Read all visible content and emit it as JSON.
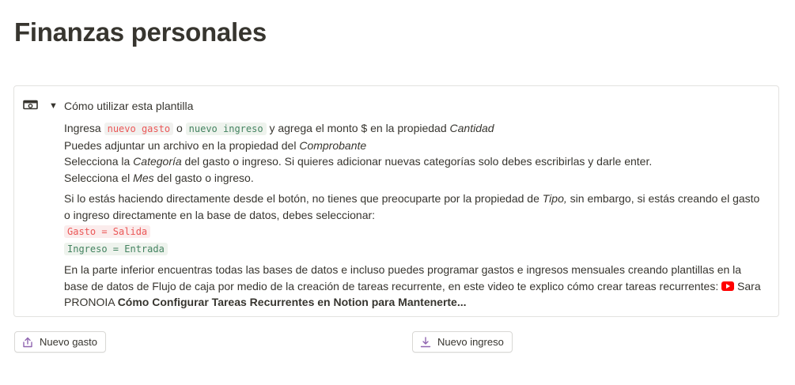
{
  "page": {
    "title": "Finanzas personales"
  },
  "callout": {
    "icon": "money-icon",
    "toggle_title": "Cómo utilizar esta plantilla",
    "line1": {
      "a": "Ingresa ",
      "code1": "nuevo gasto",
      "b": " o ",
      "code2": "nuevo ingreso",
      "c": " y agrega el monto $ en la propiedad ",
      "em": "Cantidad"
    },
    "line2": {
      "a": "Puedes adjuntar un archivo en la propiedad del ",
      "em": "Comprobante"
    },
    "line3": {
      "a": "Selecciona la ",
      "em": "Categoría",
      "b": " del gasto o ingreso. Si quieres adicionar nuevas categorías solo debes escribirlas y darle enter."
    },
    "line4": {
      "a": "Selecciona el ",
      "em": "Mes",
      "b": " del gasto o ingreso."
    },
    "para2": {
      "a": "Si lo estás haciendo directamente desde el botón, no tienes que preocuparte por la propiedad de ",
      "em": "Tipo,",
      "b": " sin embargo, si estás creando el gasto o ingreso directamente en la base de datos, debes seleccionar:"
    },
    "code_gasto": "Gasto = Salida",
    "code_ingreso": "Ingreso = Entrada",
    "para3": {
      "a": "En la parte inferior encuentras todas las bases de datos e incluso puedes programar gastos e ingresos mensuales creando plantillas en la base de datos de Flujo de caja por medio de la creación de tareas recurrente, en este video te explico cómo crear tareas recurrentes: ",
      "author": " Sara PRONOIA ",
      "link": "Cómo Configurar Tareas Recurrentes en Notion para Mantenerte..."
    }
  },
  "buttons": {
    "gasto": {
      "label": "Nuevo gasto",
      "icon": "upload-icon"
    },
    "ingreso": {
      "label": "Nuevo ingreso",
      "icon": "download-icon"
    }
  },
  "colors": {
    "accent_purple": "#9065b0",
    "code_red": "#eb5757",
    "code_green": "#448361",
    "youtube_red": "#ff0000"
  }
}
